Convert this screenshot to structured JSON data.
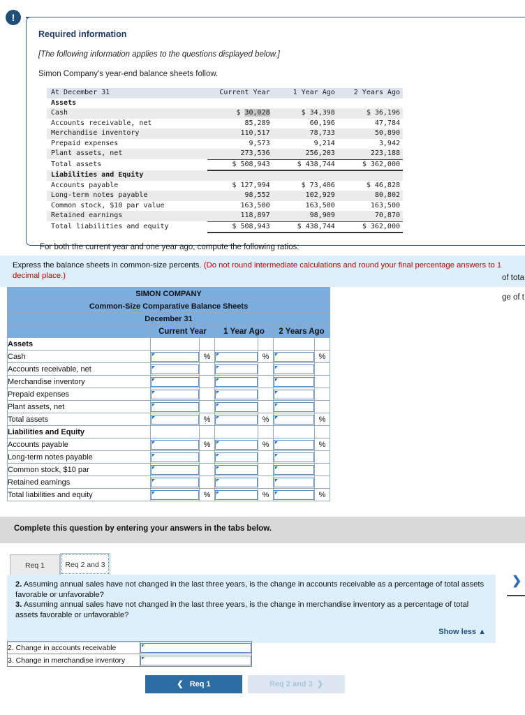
{
  "alert": {
    "icon": "exclamation-icon",
    "glyph": "!"
  },
  "required_information": {
    "heading": "Required information",
    "italic_note": "[The following information applies to the questions displayed below.]",
    "lead": "Simon Company's year-end balance sheets follow.",
    "footer": "For both the current year and one year ago, compute the following ratios:",
    "balance_sheet": {
      "header": [
        "At December 31",
        "Current Year",
        "1 Year Ago",
        "2 Years Ago"
      ],
      "sections": [
        {
          "group": "Assets",
          "rows": [
            {
              "label": "Cash",
              "values": [
                "$ 30,028",
                "$ 34,398",
                "$ 36,196"
              ],
              "highlight": true
            },
            {
              "label": "Accounts receivable, net",
              "values": [
                "85,289",
                "60,196",
                "47,784"
              ]
            },
            {
              "label": "Merchandise inventory",
              "values": [
                "110,517",
                "78,733",
                "50,890"
              ]
            },
            {
              "label": "Prepaid expenses",
              "values": [
                "9,573",
                "9,214",
                "3,942"
              ]
            },
            {
              "label": "Plant assets, net",
              "values": [
                "273,536",
                "256,203",
                "223,188"
              ]
            }
          ],
          "total": {
            "label": "Total assets",
            "values": [
              "$ 508,943",
              "$ 438,744",
              "$ 362,000"
            ]
          }
        },
        {
          "group": "Liabilities and Equity",
          "rows": [
            {
              "label": "Accounts payable",
              "values": [
                "$ 127,994",
                "$ 73,406",
                "$ 46,828"
              ]
            },
            {
              "label": "Long-term notes payable",
              "values": [
                "98,552",
                "102,929",
                "80,802"
              ]
            },
            {
              "label": "Common stock, $10 par value",
              "values": [
                "163,500",
                "163,500",
                "163,500"
              ]
            },
            {
              "label": "Retained earnings",
              "values": [
                "118,897",
                "98,909",
                "70,870"
              ]
            }
          ],
          "total": {
            "label": "Total liabilities and equity",
            "values": [
              "$ 508,943",
              "$ 438,744",
              "$ 362,000"
            ]
          }
        }
      ]
    }
  },
  "instruction": {
    "black_text": "Express the balance sheets in common-size percents.",
    "red_text": "(Do not round intermediate calculations and round your final percentage answers to 1 decimal place.)",
    "red_color": "#c00000",
    "background": "#ddeffb"
  },
  "clipped_fragments": {
    "frag_1": "of tota",
    "frag_2": "ge of t"
  },
  "common_size_table": {
    "title_lines": [
      "SIMON COMPANY",
      "Common-Size Comparative Balance Sheets",
      "December 31"
    ],
    "column_headers": [
      "Current Year",
      "1 Year Ago",
      "2 Years Ago"
    ],
    "header_color": "#7cade0",
    "percent_symbol": "%",
    "rows": [
      {
        "label": "Assets",
        "type": "group"
      },
      {
        "label": "Cash",
        "type": "input",
        "show_pct": true,
        "values": [
          "",
          "",
          ""
        ]
      },
      {
        "label": "Accounts receivable, net",
        "type": "input",
        "show_pct": false,
        "values": [
          "",
          "",
          ""
        ]
      },
      {
        "label": "Merchandise inventory",
        "type": "input",
        "show_pct": false,
        "values": [
          "",
          "",
          ""
        ]
      },
      {
        "label": "Prepaid expenses",
        "type": "input",
        "show_pct": false,
        "values": [
          "",
          "",
          ""
        ]
      },
      {
        "label": "Plant assets, net",
        "type": "input",
        "show_pct": false,
        "values": [
          "",
          "",
          ""
        ]
      },
      {
        "label": "Total assets",
        "type": "input",
        "show_pct": true,
        "values": [
          "",
          "",
          ""
        ]
      },
      {
        "label": "Liabilities and Equity",
        "type": "group"
      },
      {
        "label": "Accounts payable",
        "type": "input",
        "show_pct": true,
        "values": [
          "",
          "",
          ""
        ]
      },
      {
        "label": "Long-term notes payable",
        "type": "input",
        "show_pct": false,
        "values": [
          "",
          "",
          ""
        ]
      },
      {
        "label": "Common stock, $10 par",
        "type": "input",
        "show_pct": false,
        "values": [
          "",
          "",
          ""
        ]
      },
      {
        "label": "Retained earnings",
        "type": "input",
        "show_pct": false,
        "values": [
          "",
          "",
          ""
        ]
      },
      {
        "label": "Total liabilities and equity",
        "type": "input",
        "show_pct": true,
        "values": [
          "",
          "",
          ""
        ]
      }
    ]
  },
  "complete_banner": {
    "text": "Complete this question by entering your answers in the tabs below."
  },
  "tabs": [
    {
      "label": "Req 1",
      "active": false
    },
    {
      "label": "Req 2 and 3",
      "active": true
    }
  ],
  "question_block": {
    "q2_number": "2.",
    "q2_text": " Assuming annual sales have not changed in the last three years, is the change in accounts receivable as a percentage of total assets favorable or unfavorable?",
    "q3_number": "3.",
    "q3_text": " Assuming annual sales have not changed in the last three years, is the change in merchandise inventory as a percentage of total assets favorable or unfavorable?",
    "show_less": "Show less ▲"
  },
  "answer_rows": [
    {
      "label": "2. Change in accounts receivable",
      "value": ""
    },
    {
      "label": "3. Change in merchandise inventory",
      "value": ""
    }
  ],
  "nav": {
    "prev_label": "Req 1",
    "prev_chevron": "❮",
    "next_label": "Req 2 and 3",
    "next_chevron": "❯",
    "prev_color": "#2e6da4",
    "next_color": "#dce7f2"
  },
  "right_nav": {
    "chevron": "❯"
  }
}
